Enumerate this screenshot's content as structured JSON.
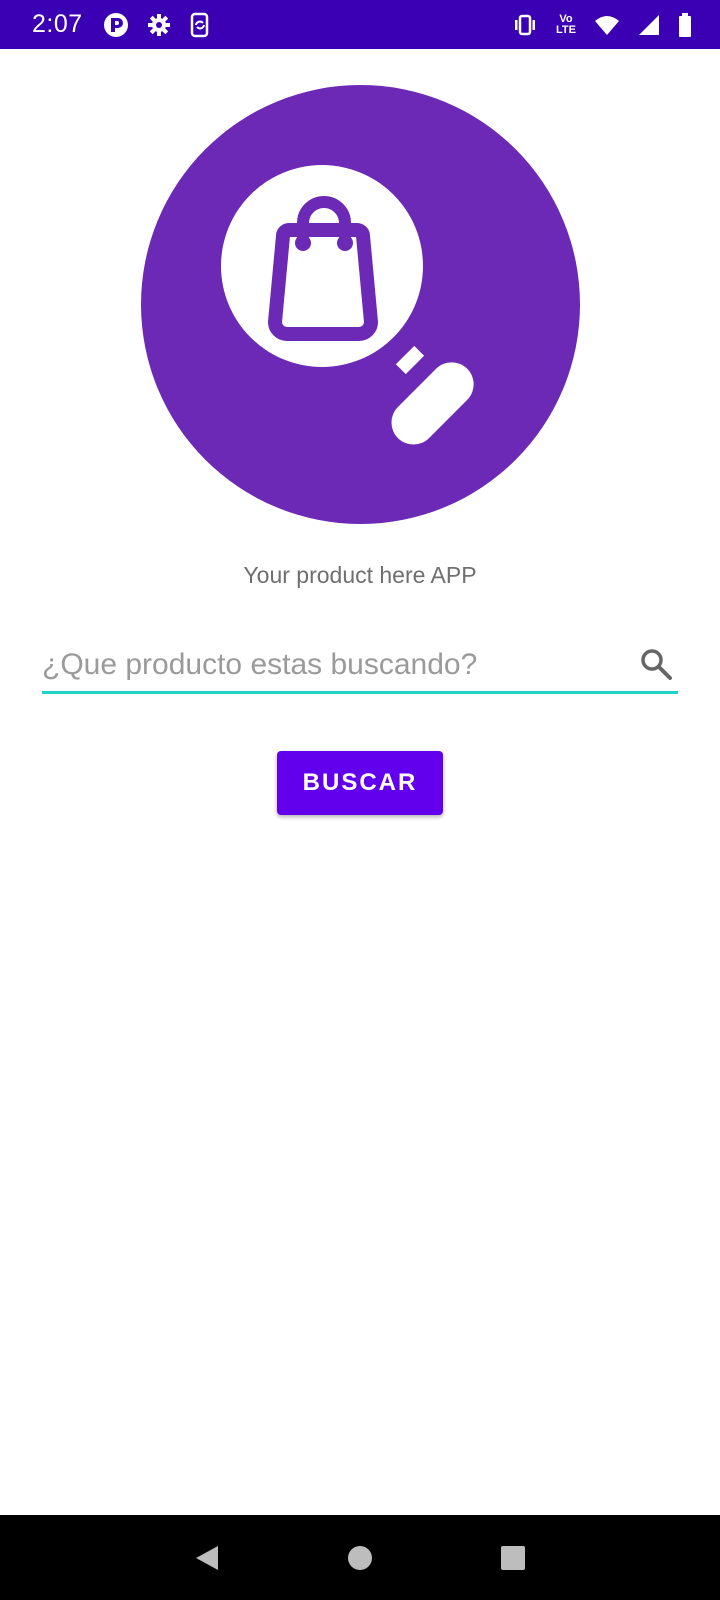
{
  "status_bar": {
    "time": "2:07",
    "left_icons": [
      "app-notification-icon",
      "gear-icon",
      "screen-rotate-icon"
    ],
    "right_icons": [
      "vibrate-icon",
      "volte-icon",
      "wifi-icon",
      "signal-icon",
      "battery-icon"
    ],
    "volte_top": "Vo",
    "volte_bottom": "LTE",
    "background": "#3b00b3"
  },
  "logo": {
    "icon": "shopping-bag-magnifier-icon",
    "circle_color": "#6c29b5"
  },
  "app_title": "Your product here APP",
  "search": {
    "placeholder": "¿Que producto estas buscando?",
    "value": "",
    "icon": "search-icon",
    "underline_color": "#1fd3c6"
  },
  "buscar_button": {
    "label": "BUSCAR",
    "color": "#6200ee"
  },
  "nav_bar": {
    "buttons": [
      "back-icon",
      "home-icon",
      "recents-icon"
    ]
  }
}
